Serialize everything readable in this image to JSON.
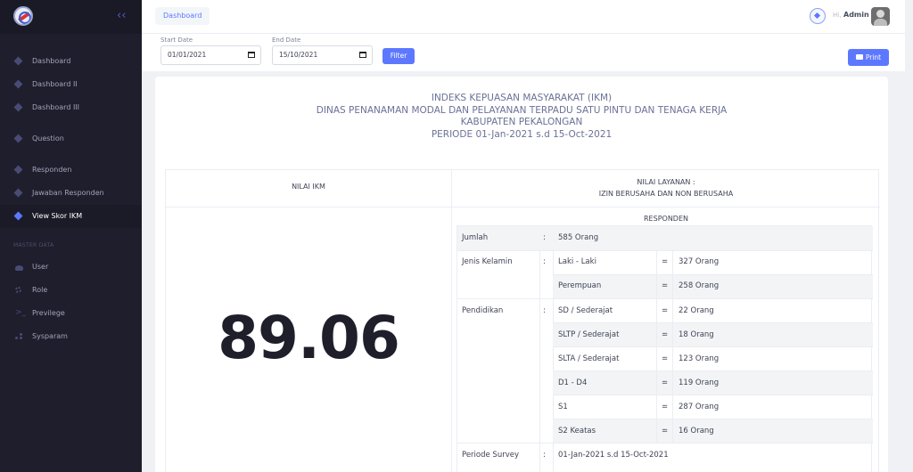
{
  "sidebar": {
    "items": [
      {
        "label": "Dashboard"
      },
      {
        "label": "Dashboard II"
      },
      {
        "label": "Dashboard III"
      },
      {
        "label": "Question"
      },
      {
        "label": "Responden"
      },
      {
        "label": "Jawaban Responden"
      },
      {
        "label": "View Skor IKM"
      }
    ],
    "section_label": "MASTER DATA",
    "master_items": [
      {
        "label": "User"
      },
      {
        "label": "Role"
      },
      {
        "label": "Previlege"
      },
      {
        "label": "Sysparam"
      }
    ]
  },
  "header": {
    "breadcrumb": "Dashboard",
    "greeting": "Hi,",
    "username": "Admin"
  },
  "filter": {
    "start_label": "Start Date",
    "start_value": "01/01/2021",
    "end_label": "End Date",
    "end_value": "15/10/2021",
    "filter_button": "Filter",
    "print_button": "Print"
  },
  "report": {
    "title_lines": [
      "INDEKS KEPUASAN MASYARAKAT (IKM)",
      "DINAS PENANAMAN MODAL DAN PELAYANAN TERPADU SATU PINTU DAN TENAGA KERJA",
      "KABUPATEN PEKALONGAN",
      "PERIODE 01-Jan-2021 s.d 15-Oct-2021"
    ],
    "nilai_ikm_header": "NILAI IKM",
    "nilai_layanan_line1": "NILAI LAYANAN :",
    "nilai_layanan_line2": "IZIN BERUSAHA DAN NON BERUSAHA",
    "score": "89.06",
    "responden_header": "RESPONDEN",
    "colon": ":",
    "equals": "=",
    "jumlah_label": "Jumlah",
    "jumlah_value": "585 Orang",
    "jk_label": "Jenis Kelamin",
    "jk_rows": [
      {
        "name": "Laki - Laki",
        "value": "327 Orang"
      },
      {
        "name": "Perempuan",
        "value": "258 Orang"
      }
    ],
    "pend_label": "Pendidikan",
    "pend_rows": [
      {
        "name": "SD / Sederajat",
        "value": "22 Orang"
      },
      {
        "name": "SLTP / Sederajat",
        "value": "18 Orang"
      },
      {
        "name": "SLTA / Sederajat",
        "value": "123 Orang"
      },
      {
        "name": "D1 - D4",
        "value": "119 Orang"
      },
      {
        "name": "S1",
        "value": "287 Orang"
      },
      {
        "name": "S2 Keatas",
        "value": "16 Orang"
      }
    ],
    "periode_label": "Periode Survey",
    "periode_value": "01-Jan-2021 s.d 15-Oct-2021"
  },
  "colors": {
    "accent": "#5d78ff",
    "sidebar_bg": "#1e1e2d",
    "title_text": "#6b7196"
  }
}
